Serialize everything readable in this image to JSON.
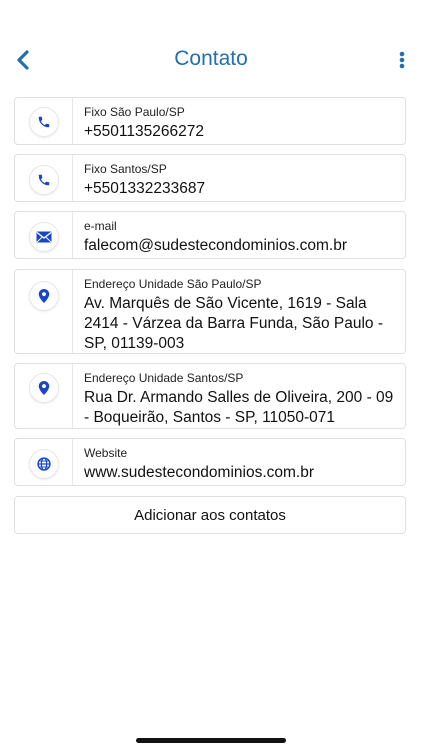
{
  "header": {
    "title": "Contato"
  },
  "contacts": [
    {
      "label": "Fixo São Paulo/SP",
      "value": "+5501135266272",
      "icon": "phone-icon"
    },
    {
      "label": "Fixo Santos/SP",
      "value": "+5501332233687",
      "icon": "phone-icon"
    },
    {
      "label": "e-mail",
      "value": "falecom@sudestecondominios.com.br",
      "icon": "envelope-icon"
    },
    {
      "label": "Endereço Unidade São Paulo/SP",
      "value": "Av. Marquês de São Vicente, 1619 - Sala 2414 - Várzea da Barra Funda, São Paulo - SP, 01139-003",
      "icon": "location-pin-icon"
    },
    {
      "label": "Endereço Unidade Santos/SP",
      "value": "Rua Dr. Armando Salles de Oliveira, 200 - 09 - Boqueirão, Santos - SP, 11050-071",
      "icon": "location-pin-icon"
    },
    {
      "label": "Website",
      "value": "www.sudestecondominios.com.br",
      "icon": "globe-icon"
    }
  ],
  "add_button_label": "Adicionar aos contatos",
  "colors": {
    "accent": "#1f6fb2",
    "icon": "#1747c8"
  }
}
